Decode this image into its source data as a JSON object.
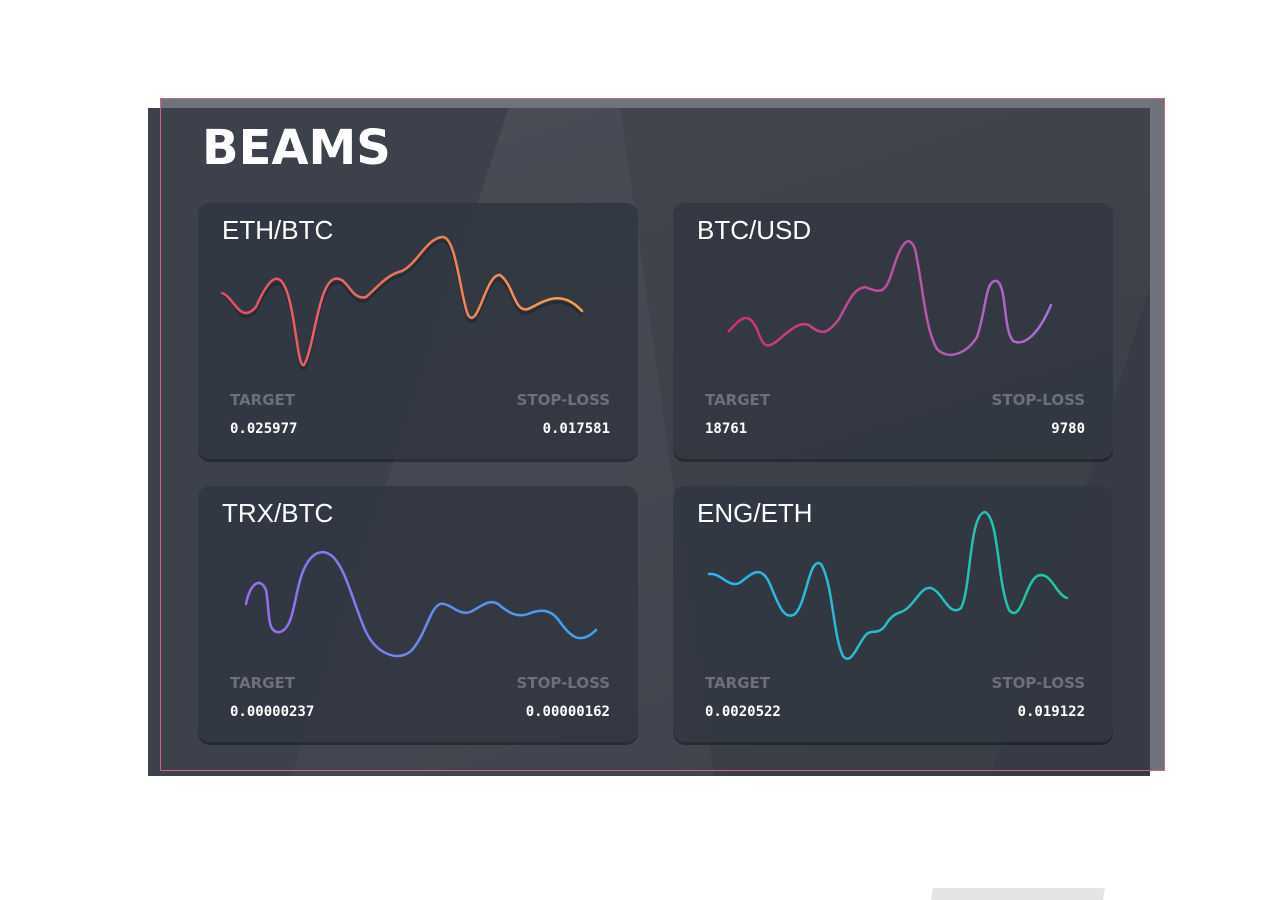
{
  "app": {
    "title": "BEAMS"
  },
  "labels": {
    "target": "TARGET",
    "stop_loss": "STOP-LOSS"
  },
  "cards": [
    {
      "pair": "ETH/BTC",
      "target": "0.025977",
      "stop_loss": "0.017581",
      "gradient": [
        "#e64a6a",
        "#f8a14a"
      ]
    },
    {
      "pair": "BTC/USD",
      "target": "18761",
      "stop_loss": "9780",
      "gradient": [
        "#d0306a",
        "#a870d8"
      ]
    },
    {
      "pair": "TRX/BTC",
      "target": "0.00000237",
      "stop_loss": "0.00000162",
      "gradient": [
        "#9a6cf0",
        "#3aa6ee"
      ]
    },
    {
      "pair": "ENG/ETH",
      "target": "0.0020522",
      "stop_loss": "0.019122",
      "gradient": [
        "#2eb4f0",
        "#1ec8a0"
      ]
    }
  ]
}
